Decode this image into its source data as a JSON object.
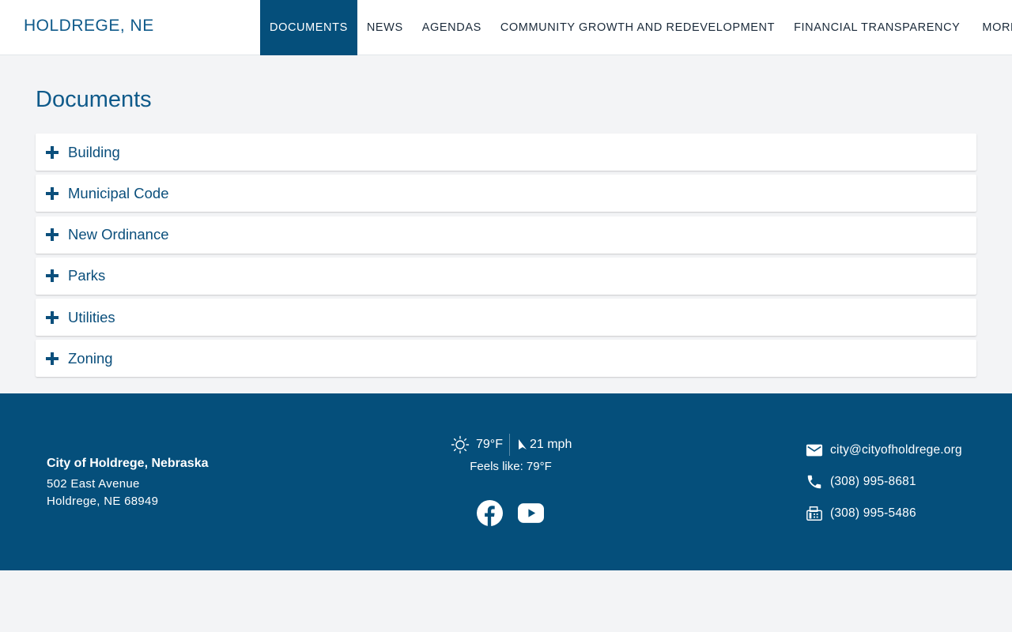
{
  "header": {
    "site_title": "HOLDREGE, NE",
    "nav": [
      {
        "label": "DOCUMENTS",
        "active": true
      },
      {
        "label": "NEWS"
      },
      {
        "label": "AGENDAS"
      },
      {
        "label": "COMMUNITY GROWTH AND REDEVELOPMENT"
      },
      {
        "label": "FINANCIAL TRANSPARENCY"
      },
      {
        "label": "MORE"
      }
    ]
  },
  "main": {
    "page_title": "Documents",
    "sections": [
      {
        "label": "Building"
      },
      {
        "label": "Municipal Code"
      },
      {
        "label": "New Ordinance"
      },
      {
        "label": "Parks"
      },
      {
        "label": "Utilities"
      },
      {
        "label": "Zoning"
      }
    ]
  },
  "footer": {
    "org_name": "City of Holdrege, Nebraska",
    "address_line1": "502 East Avenue",
    "address_line2": "Holdrege, NE 68949",
    "weather": {
      "temperature": "79°F",
      "wind": "21 mph",
      "feels_like": "Feels like: 79°F"
    },
    "social": [
      {
        "icon": "facebook-icon"
      },
      {
        "icon": "youtube-icon"
      }
    ],
    "contact": {
      "email": "city@cityofholdrege.org",
      "phone": "(308) 995-8681",
      "fax": "(308) 995-5486"
    }
  },
  "colors": {
    "brand": "#054f7b",
    "background": "#f3f4f6"
  }
}
